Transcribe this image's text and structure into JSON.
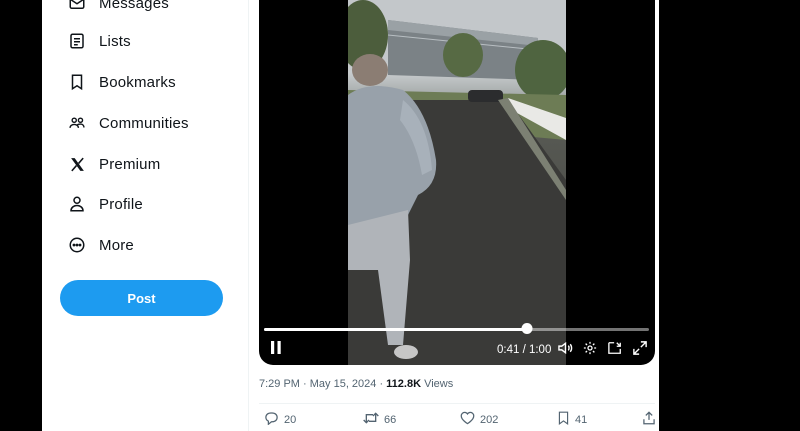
{
  "sidebar": {
    "items": [
      {
        "label": "Messages",
        "icon": "mail-icon"
      },
      {
        "label": "Lists",
        "icon": "lists-icon"
      },
      {
        "label": "Bookmarks",
        "icon": "bookmark-icon"
      },
      {
        "label": "Communities",
        "icon": "communities-icon"
      },
      {
        "label": "Premium",
        "icon": "x-logo-icon"
      },
      {
        "label": "Profile",
        "icon": "profile-icon"
      },
      {
        "label": "More",
        "icon": "more-circle-icon"
      }
    ],
    "post_label": "Post"
  },
  "video": {
    "time": "0:41 / 1:00",
    "progress_fraction": 0.6833
  },
  "tweet": {
    "timestamp": "7:29 PM · May 15, 2024 · ",
    "views_count": "112.8K",
    "views_label": " Views"
  },
  "actions": {
    "replies": "20",
    "reposts": "66",
    "likes": "202",
    "bookmarks": "41"
  },
  "colors": {
    "accent": "#1d9bf0",
    "text": "#0f1419",
    "secondary": "#536471"
  }
}
